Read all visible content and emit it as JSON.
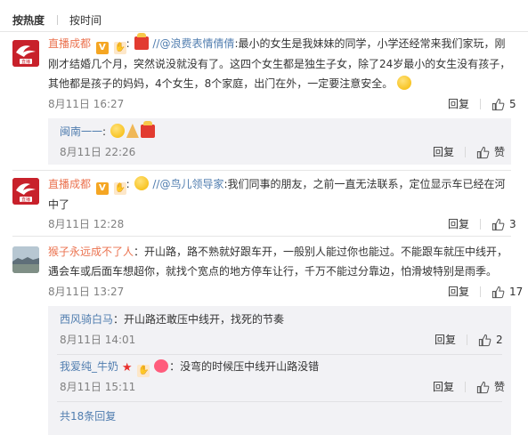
{
  "sort": {
    "active": "按热度",
    "other": "按时间"
  },
  "comments": [
    {
      "user": "直播成都",
      "colon": ":",
      "mention": "//@浪费表情倩倩",
      "text": ":最小的女生是我妹妹的同学，小学还经常来我们家玩，刚刚才结婚几个月，突然说没就没有了。这四个女生都是独生子女，除了24岁最小的女生没有孩子，其他都是孩子的妈妈，4个女生，8个家庭，出门在外，一定要注意安全。",
      "time": "8月11日 16:27",
      "reply_label": "回复",
      "likes": "5",
      "replies": [
        {
          "user": "闽南一一",
          "colon": ":",
          "time": "8月11日 22:26",
          "reply_label": "回复",
          "likes": "赞"
        }
      ]
    },
    {
      "user": "直播成都",
      "colon": ":",
      "mention": "//@鸟儿领导家",
      "text": ":我们同事的朋友，之前一直无法联系，定位显示车已经在河中了",
      "time": "8月11日 12:28",
      "reply_label": "回复",
      "likes": "3"
    },
    {
      "user": "猴子永远成不了人",
      "colon": "：",
      "text": "开山路，路不熟就好跟车开，一般别人能过你也能过。不能跟车就压中线开，遇会车或后面车想超你，就找个宽点的地方停车让行，千万不能过分靠边，怕滑坡特别是雨季。",
      "time": "8月11日 13:27",
      "reply_label": "回复",
      "likes": "17",
      "replies": [
        {
          "user": "西风骑白马",
          "colon": "：",
          "text": "开山路还敢压中线开，找死的节奏",
          "time": "8月11日 14:01",
          "reply_label": "回复",
          "likes": "2"
        },
        {
          "user": "我爱纯_牛奶",
          "colon": "：",
          "text": "没弯的时候压中线开山路没错",
          "time": "8月11日 15:11",
          "reply_label": "回复",
          "likes": "赞"
        }
      ],
      "more_label": "共18条回复"
    }
  ],
  "colors": {
    "username": "#eb7350",
    "link": "#507daf",
    "meta": "#808080",
    "reply_bg": "#f2f2f5"
  }
}
